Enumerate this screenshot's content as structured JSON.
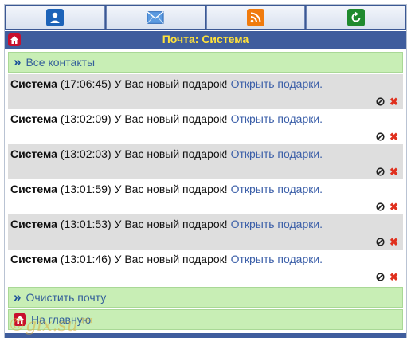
{
  "toolbar": {
    "buttons": [
      {
        "icon": "user-icon"
      },
      {
        "icon": "mail-icon"
      },
      {
        "icon": "rss-icon"
      },
      {
        "icon": "refresh-icon"
      }
    ]
  },
  "header": {
    "title": "Почта: Система"
  },
  "nav": {
    "all_contacts": "Все контакты",
    "clear_mail": "Очистить почту",
    "home": "На главную"
  },
  "messages": [
    {
      "sender": "Система",
      "time": "(17:06:45)",
      "text": "У Вас новый подарок!",
      "link": "Открыть подарки."
    },
    {
      "sender": "Система",
      "time": "(13:02:09)",
      "text": "У Вас новый подарок!",
      "link": "Открыть подарки."
    },
    {
      "sender": "Система",
      "time": "(13:02:03)",
      "text": "У Вас новый подарок!",
      "link": "Открыть подарки."
    },
    {
      "sender": "Система",
      "time": "(13:01:59)",
      "text": "У Вас новый подарок!",
      "link": "Открыть подарки."
    },
    {
      "sender": "Система",
      "time": "(13:01:53)",
      "text": "У Вас новый подарок!",
      "link": "Открыть подарки."
    },
    {
      "sender": "Система",
      "time": "(13:01:46)",
      "text": "У Вас новый подарок!",
      "link": "Открыть подарки."
    }
  ],
  "watermark": "©gix.su™",
  "colors": {
    "header_bg": "#3f5d9d",
    "title_text": "#ffe23a",
    "nav_bg": "#c8eeb5",
    "link": "#3a5ea8",
    "delete": "#e0301e"
  }
}
